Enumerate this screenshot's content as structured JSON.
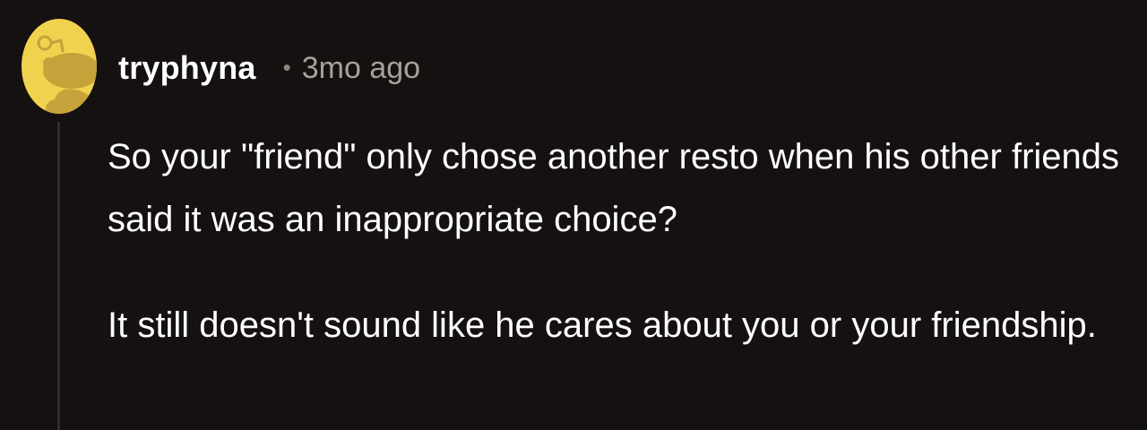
{
  "comment": {
    "username": "tryphyna",
    "separator": "•",
    "timestamp": "3mo ago",
    "paragraphs": [
      "So your \"friend\" only chose another resto when his other friends said it was an inappropriate choice?",
      "It still doesn't sound like he cares about you or your friendship."
    ]
  },
  "colors": {
    "background": "#151110",
    "avatar_bg": "#f1d24e",
    "avatar_figure": "#c7a23a",
    "text": "#ffffff",
    "timestamp": "#a8a09b",
    "thread_line": "#2f2b29"
  },
  "icons": {
    "avatar": "snoo-avatar-icon"
  }
}
